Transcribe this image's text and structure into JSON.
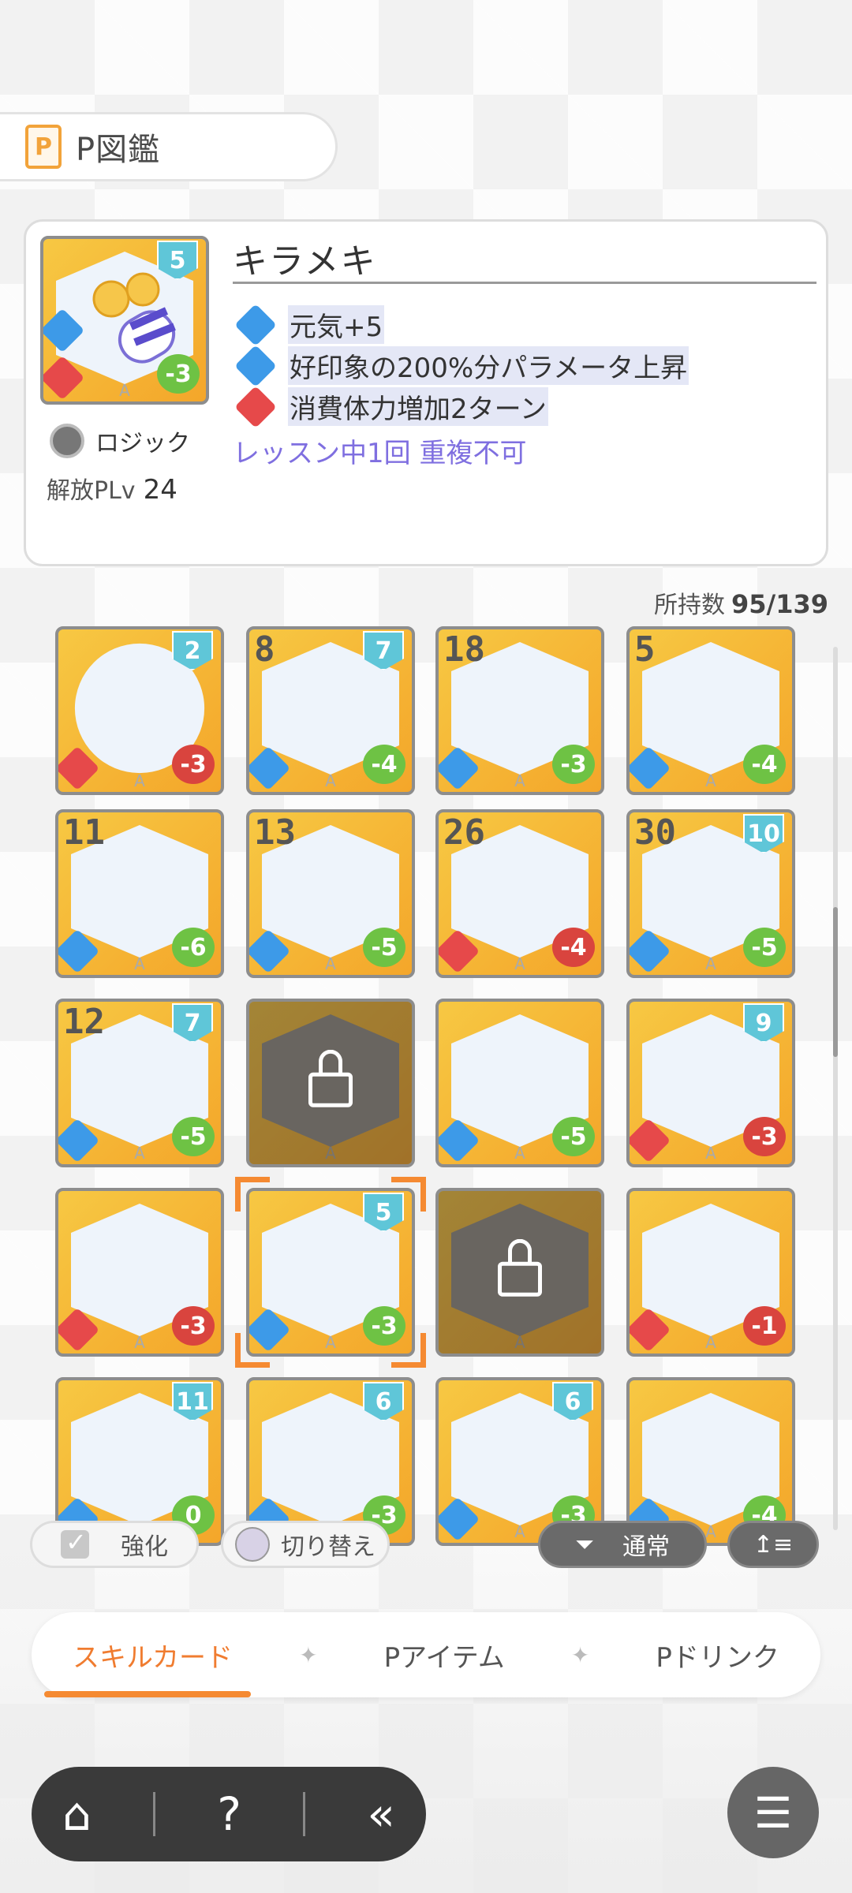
{
  "header": {
    "title": "P図鑑",
    "icon": "book-icon"
  },
  "detail": {
    "card": {
      "level": "5",
      "cost": "-3"
    },
    "name": "キラメキ",
    "effects": [
      {
        "icon": "genki-icon",
        "text": "元気+5"
      },
      {
        "icon": "thumbs-up-icon",
        "text": "好印象の200%分パラメータ上昇"
      },
      {
        "icon": "stamina-icon",
        "text": "消費体力増加2ターン"
      }
    ],
    "note": "レッスン中1回 重複不可",
    "plan": "ロジック",
    "plv_label": "解放PLv",
    "plv_value": "24"
  },
  "collection": {
    "label": "所持数",
    "value": "95/139"
  },
  "grid": [
    [
      {
        "num": "",
        "lvl": "2",
        "cost": "-3",
        "color": "red"
      },
      {
        "num": "8",
        "lvl": "7",
        "cost": "-4",
        "color": "green"
      },
      {
        "num": "18",
        "lvl": "",
        "cost": "-3",
        "color": "green"
      },
      {
        "num": "5",
        "lvl": "",
        "cost": "-4",
        "color": "green"
      }
    ],
    [
      {
        "num": "11",
        "lvl": "",
        "cost": "-6",
        "color": "green"
      },
      {
        "num": "13",
        "lvl": "",
        "cost": "-5",
        "color": "green"
      },
      {
        "num": "26",
        "lvl": "",
        "cost": "-4",
        "color": "red"
      },
      {
        "num": "30",
        "lvl": "10",
        "cost": "-5",
        "color": "green"
      }
    ],
    [
      {
        "num": "12",
        "lvl": "7",
        "cost": "-5",
        "color": "green"
      },
      {
        "num": "",
        "lvl": "",
        "cost": "",
        "locked": true
      },
      {
        "num": "",
        "lvl": "",
        "cost": "-5",
        "color": "green"
      },
      {
        "num": "",
        "lvl": "9",
        "cost": "-3",
        "color": "red"
      }
    ],
    [
      {
        "num": "",
        "lvl": "",
        "cost": "-3",
        "color": "red"
      },
      {
        "num": "",
        "lvl": "5",
        "cost": "-3",
        "color": "green",
        "selected": true
      },
      {
        "num": "",
        "lvl": "",
        "cost": "",
        "locked": true
      },
      {
        "num": "",
        "lvl": "",
        "cost": "-1",
        "color": "red"
      }
    ],
    [
      {
        "num": "",
        "lvl": "11",
        "cost": "0",
        "color": "green"
      },
      {
        "num": "",
        "lvl": "6",
        "cost": "-3",
        "color": "green"
      },
      {
        "num": "",
        "lvl": "6",
        "cost": "-3",
        "color": "green"
      },
      {
        "num": "",
        "lvl": "",
        "cost": "-4",
        "color": "green"
      }
    ]
  ],
  "controls": {
    "enhance_label": "強化",
    "switch_label": "切り替え",
    "sort_label": "通常"
  },
  "tabs": [
    {
      "label": "スキルカード",
      "active": true
    },
    {
      "label": "Pアイテム",
      "active": false
    },
    {
      "label": "Pドリンク",
      "active": false
    }
  ],
  "nav": {
    "home": "home-icon",
    "help": "help-icon",
    "back": "back-icon",
    "menu": "menu-icon"
  }
}
